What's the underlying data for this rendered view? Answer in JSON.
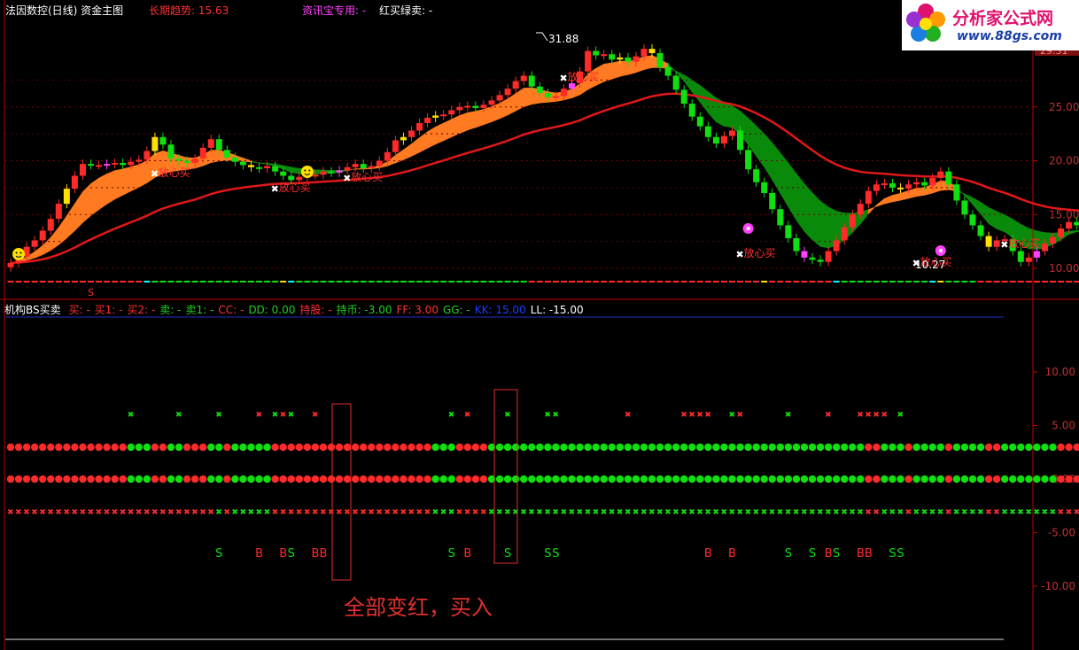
{
  "header": {
    "title": "法因数控(日线) 资金主图",
    "trend_label": "长期趋势: 15.63",
    "special": "资讯宝专用: -",
    "redgreen": "红买绿卖: -"
  },
  "logo": {
    "title": "分析家公式网",
    "url": "www.88gs.com"
  },
  "upper": {
    "axis_ticks": [
      "25.00",
      "20.00",
      "15.00",
      "10.00"
    ],
    "price_box": "29.31",
    "high_label": "31.88",
    "low_label": "10.27",
    "marker_s": "S",
    "signal_text": "放心买",
    "signal_text_cut": "放心买"
  },
  "lower": {
    "indicator": "机构BS买卖",
    "items": [
      {
        "text": "买: -",
        "color": "#ff3030"
      },
      {
        "text": "买1: -",
        "color": "#ff3030"
      },
      {
        "text": "买2: -",
        "color": "#ff3030"
      },
      {
        "text": "卖: -",
        "color": "#20d020"
      },
      {
        "text": "卖1: -",
        "color": "#20d020"
      },
      {
        "text": "CC: -",
        "color": "#ff3030"
      },
      {
        "text": "DD: 0.00",
        "color": "#20d020"
      },
      {
        "text": "持股: -",
        "color": "#ff3030"
      },
      {
        "text": "持币: -3.00",
        "color": "#20d020"
      },
      {
        "text": "FF: 3.00",
        "color": "#ff3030"
      },
      {
        "text": "GG: -",
        "color": "#20d020"
      },
      {
        "text": "KK: 15.00",
        "color": "#1a3fff"
      },
      {
        "text": "LL: -15.00",
        "color": "#ffffff"
      }
    ],
    "axis_ticks": [
      "10.00",
      "5.00",
      "0.00",
      "-5.00",
      "-10.00"
    ],
    "letter_b": "B",
    "letter_s": "S"
  },
  "annotation": "全部变红，买入",
  "colors": {
    "up": "#ff2a2a",
    "down": "#10e010",
    "yellow": "#ffe000",
    "pink": "#ff40ff",
    "orange": "#ff7a20",
    "ma_red": "#e01818",
    "darkgreen": "#0a8a0a",
    "axis": "#c00000"
  },
  "chart_data": {
    "type": "candlestick",
    "y_range_upper": [
      8,
      32
    ],
    "y_range_lower": [
      -14,
      14
    ],
    "closes": [
      10.5,
      11.1,
      12.0,
      12.6,
      13.5,
      14.6,
      16.0,
      17.4,
      18.6,
      19.7,
      19.6,
      19.6,
      19.7,
      19.8,
      19.6,
      19.9,
      20.1,
      20.9,
      22.2,
      21.5,
      20.2,
      20.0,
      19.8,
      20.2,
      21.2,
      22.0,
      21.0,
      20.3,
      19.9,
      19.6,
      19.4,
      19.3,
      19.5,
      19.0,
      18.6,
      18.2,
      18.5,
      18.7,
      18.7,
      19.0,
      18.9,
      19.1,
      19.4,
      19.7,
      19.3,
      19.5,
      20.0,
      20.8,
      21.9,
      22.2,
      22.8,
      23.5,
      24.0,
      24.2,
      24.3,
      24.7,
      25.0,
      25.1,
      24.9,
      25.2,
      25.6,
      26.1,
      26.7,
      27.4,
      27.9,
      26.9,
      26.3,
      25.9,
      26.0,
      26.7,
      27.2,
      28.3,
      30.2,
      29.8,
      29.9,
      29.4,
      29.6,
      29.2,
      29.7,
      30.4,
      30.0,
      28.7,
      27.9,
      26.6,
      25.3,
      24.1,
      23.2,
      22.2,
      21.6,
      22.3,
      22.8,
      21.0,
      19.2,
      18.0,
      17.0,
      15.5,
      14.0,
      12.8,
      11.6,
      11.0,
      10.8,
      10.6,
      11.6,
      12.6,
      13.8,
      15.0,
      16.0,
      17.2,
      17.8,
      17.9,
      17.5,
      17.4,
      17.8,
      18.0,
      17.7,
      18.4,
      19.0,
      17.8,
      16.3,
      15.0,
      14.0,
      13.0,
      12.0,
      12.6,
      12.7,
      11.6,
      10.6,
      11.0,
      11.6,
      12.3,
      12.9,
      13.7,
      14.3,
      14.0,
      13.6,
      13.0,
      12.4,
      12.0,
      12.0
    ]
  }
}
